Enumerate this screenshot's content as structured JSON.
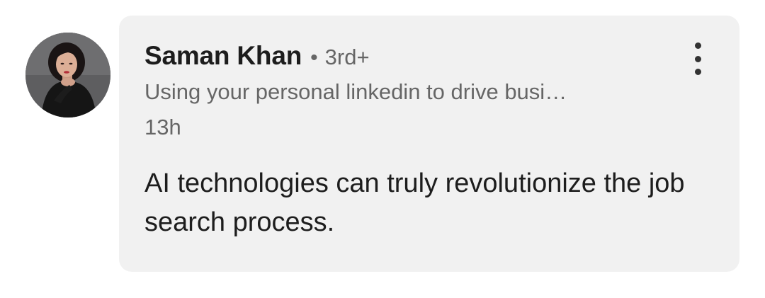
{
  "comment": {
    "author": {
      "name": "Saman Khan",
      "separator": "•",
      "degree": "3rd+",
      "headline": "Using your personal linkedin to drive busi…",
      "avatar_icon": "profile-photo"
    },
    "timestamp": "13h",
    "text": "AI technologies can truly revolutionize the job search process.",
    "more_icon": "more-vertical-icon"
  },
  "colors": {
    "bubble_bg": "#f1f1f1",
    "primary_text": "#1d1d1d",
    "secondary_text": "#666666"
  }
}
